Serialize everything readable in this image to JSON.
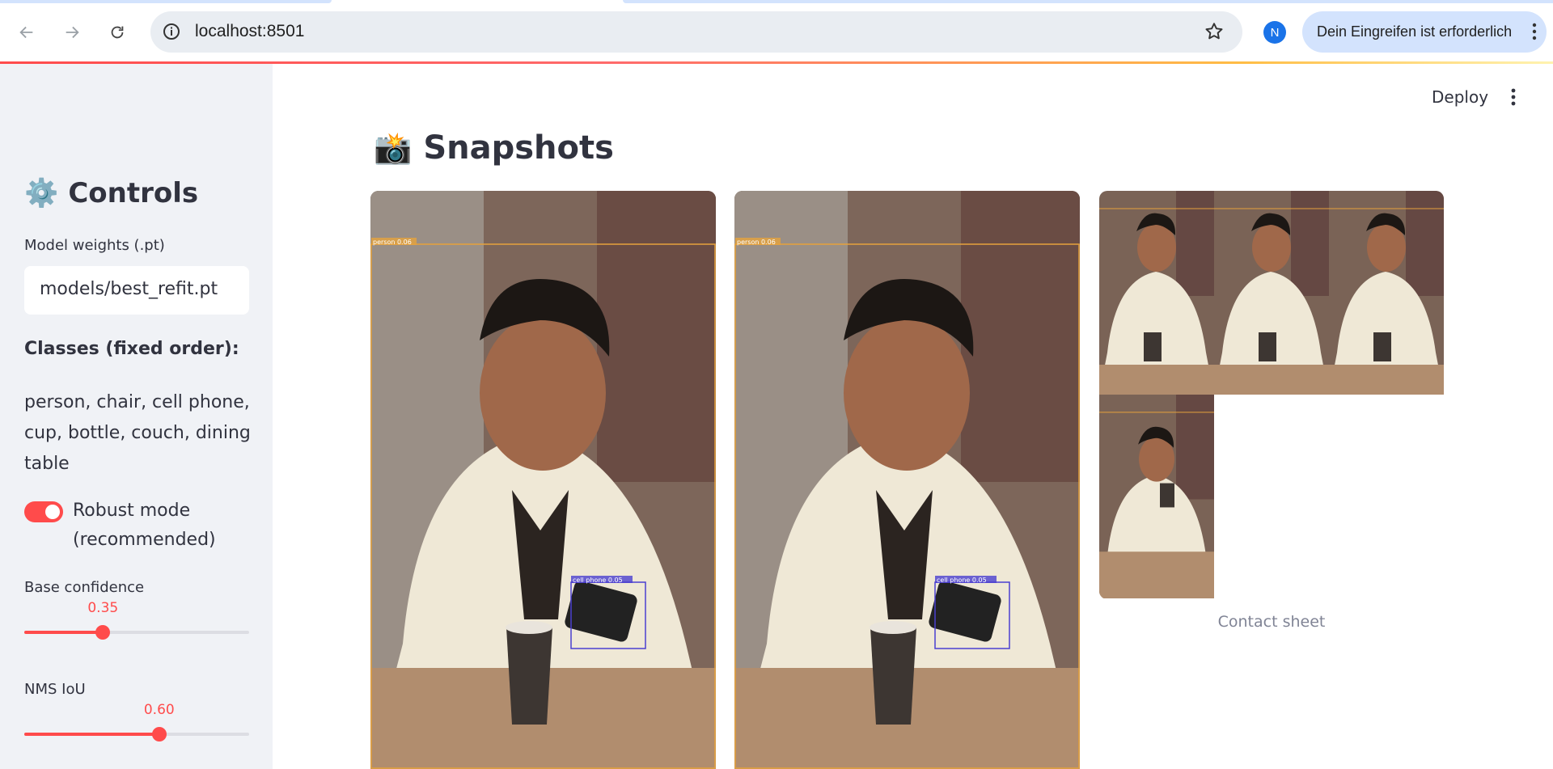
{
  "browser": {
    "url": "localhost:8501",
    "profile_initial": "N",
    "notice": "Dein Eingreifen ist erforderlich",
    "icons": [
      "back-icon",
      "forward-icon",
      "reload-icon",
      "info-icon",
      "star-icon",
      "kebab-icon"
    ]
  },
  "app": {
    "deploy_label": "Deploy"
  },
  "sidebar": {
    "title_icon": "⚙️",
    "title": "Controls",
    "weights_label": "Model weights (.pt)",
    "weights_value": "models/best_refit.pt",
    "classes_heading": "Classes (fixed order):",
    "classes_list": "person, chair, cell phone, cup, bottle, couch, dining table",
    "robust_label": "Robust mode (recommended)",
    "robust_on": true,
    "base_conf_label": "Base confidence",
    "base_conf_value": "0.35",
    "base_conf_fraction": 0.35,
    "nms_label": "NMS IoU",
    "nms_value": "0.60",
    "nms_fraction": 0.6
  },
  "main": {
    "title_icon": "📸",
    "title": "Snapshots",
    "snapshots": [
      {
        "detections": [
          {
            "label": "person 0.06"
          },
          {
            "label": "cell phone 0.05"
          }
        ]
      },
      {
        "detections": [
          {
            "label": "person 0.06"
          },
          {
            "label": "cell phone 0.05"
          }
        ]
      }
    ],
    "contact_sheet_caption": "Contact sheet"
  },
  "colors": {
    "accent": "#ff4b4b",
    "sidebar_bg": "#f0f2f6",
    "person_box": "#e6a23c",
    "phone_box": "#4a3fd0"
  }
}
